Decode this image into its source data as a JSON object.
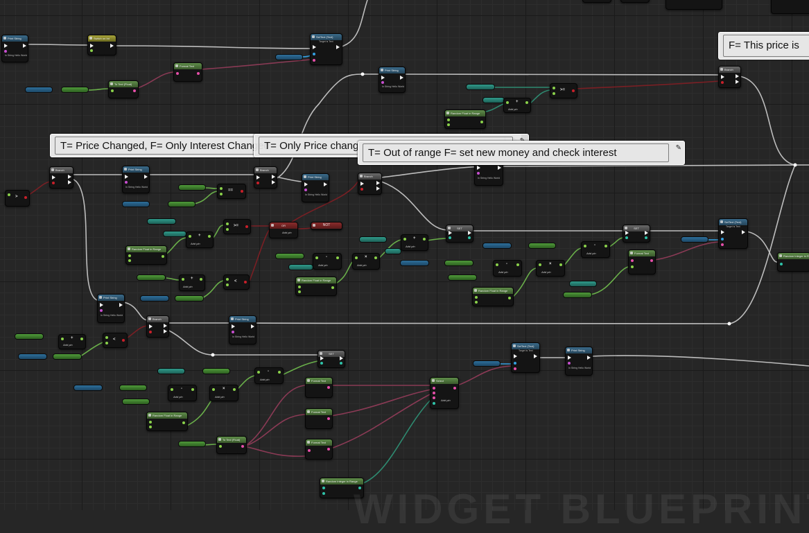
{
  "comments": {
    "price_changed": "T= Price Changed, F= Only Interest Changed",
    "only_price": "T= Only Price changed, F= Interest Changed",
    "out_of_range": "T= Out of range F= set new money and check interest",
    "this_price": "F= This price is"
  },
  "nodes": {
    "print_string": "Print String",
    "branch": "Branch",
    "switch": "Switch on Int",
    "set_text": "SetText (Text)",
    "target_text": "Target is Text",
    "format_text": "Format Text",
    "to_text": "To Text (Float)",
    "random_float": "Random Float in Range",
    "random_int": "Random Integer in Range",
    "select": "Select",
    "set": "SET",
    "not": "NOT",
    "or": "OR",
    "add_pin": "Add pin",
    "in_string": "In String Hello World"
  },
  "operators": {
    "gt": ">",
    "lt": "<",
    "gte": ">=",
    "eq": "==",
    "plus": "+",
    "minus": "-",
    "times": "×"
  },
  "watermark": "WIDGET BLUEPRINT",
  "colors": {
    "background": "#262626",
    "exec_wire": "#cfcfcf",
    "float_wire": "#7bd14a",
    "text_wire": "#d6577d",
    "bool_wire": "#8c1f26"
  }
}
